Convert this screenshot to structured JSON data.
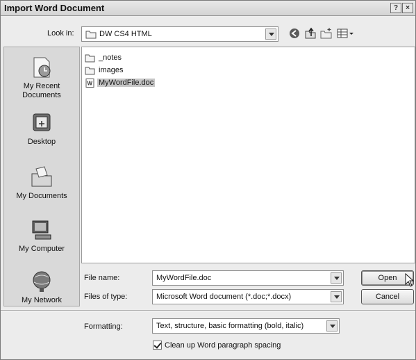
{
  "window": {
    "title": "Import Word Document",
    "help_glyph": "?",
    "close_glyph": "×"
  },
  "look_in": {
    "label": "Look in:",
    "value": "DW CS4 HTML",
    "toolbar_icons": [
      "back-icon",
      "up-folder-icon",
      "new-folder-icon",
      "view-menu-icon"
    ]
  },
  "places": [
    {
      "label": "My Recent Documents",
      "icon": "recent-documents-icon"
    },
    {
      "label": "Desktop",
      "icon": "desktop-icon"
    },
    {
      "label": "My Documents",
      "icon": "my-documents-icon"
    },
    {
      "label": "My Computer",
      "icon": "my-computer-icon"
    },
    {
      "label": "My Network",
      "icon": "network-icon"
    }
  ],
  "files": [
    {
      "name": "_notes",
      "type": "folder",
      "selected": false
    },
    {
      "name": "images",
      "type": "folder",
      "selected": false
    },
    {
      "name": "MyWordFile.doc",
      "type": "word-document",
      "selected": true
    }
  ],
  "file_name": {
    "label": "File name:",
    "value": "MyWordFile.doc"
  },
  "file_type": {
    "label": "Files of type:",
    "value": "Microsoft Word document (*.doc;*.docx)"
  },
  "buttons": {
    "open": "Open",
    "cancel": "Cancel"
  },
  "formatting": {
    "label": "Formatting:",
    "value": "Text, structure, basic formatting (bold, italic)"
  },
  "cleanup": {
    "label": "Clean up Word paragraph spacing",
    "checked": true
  }
}
